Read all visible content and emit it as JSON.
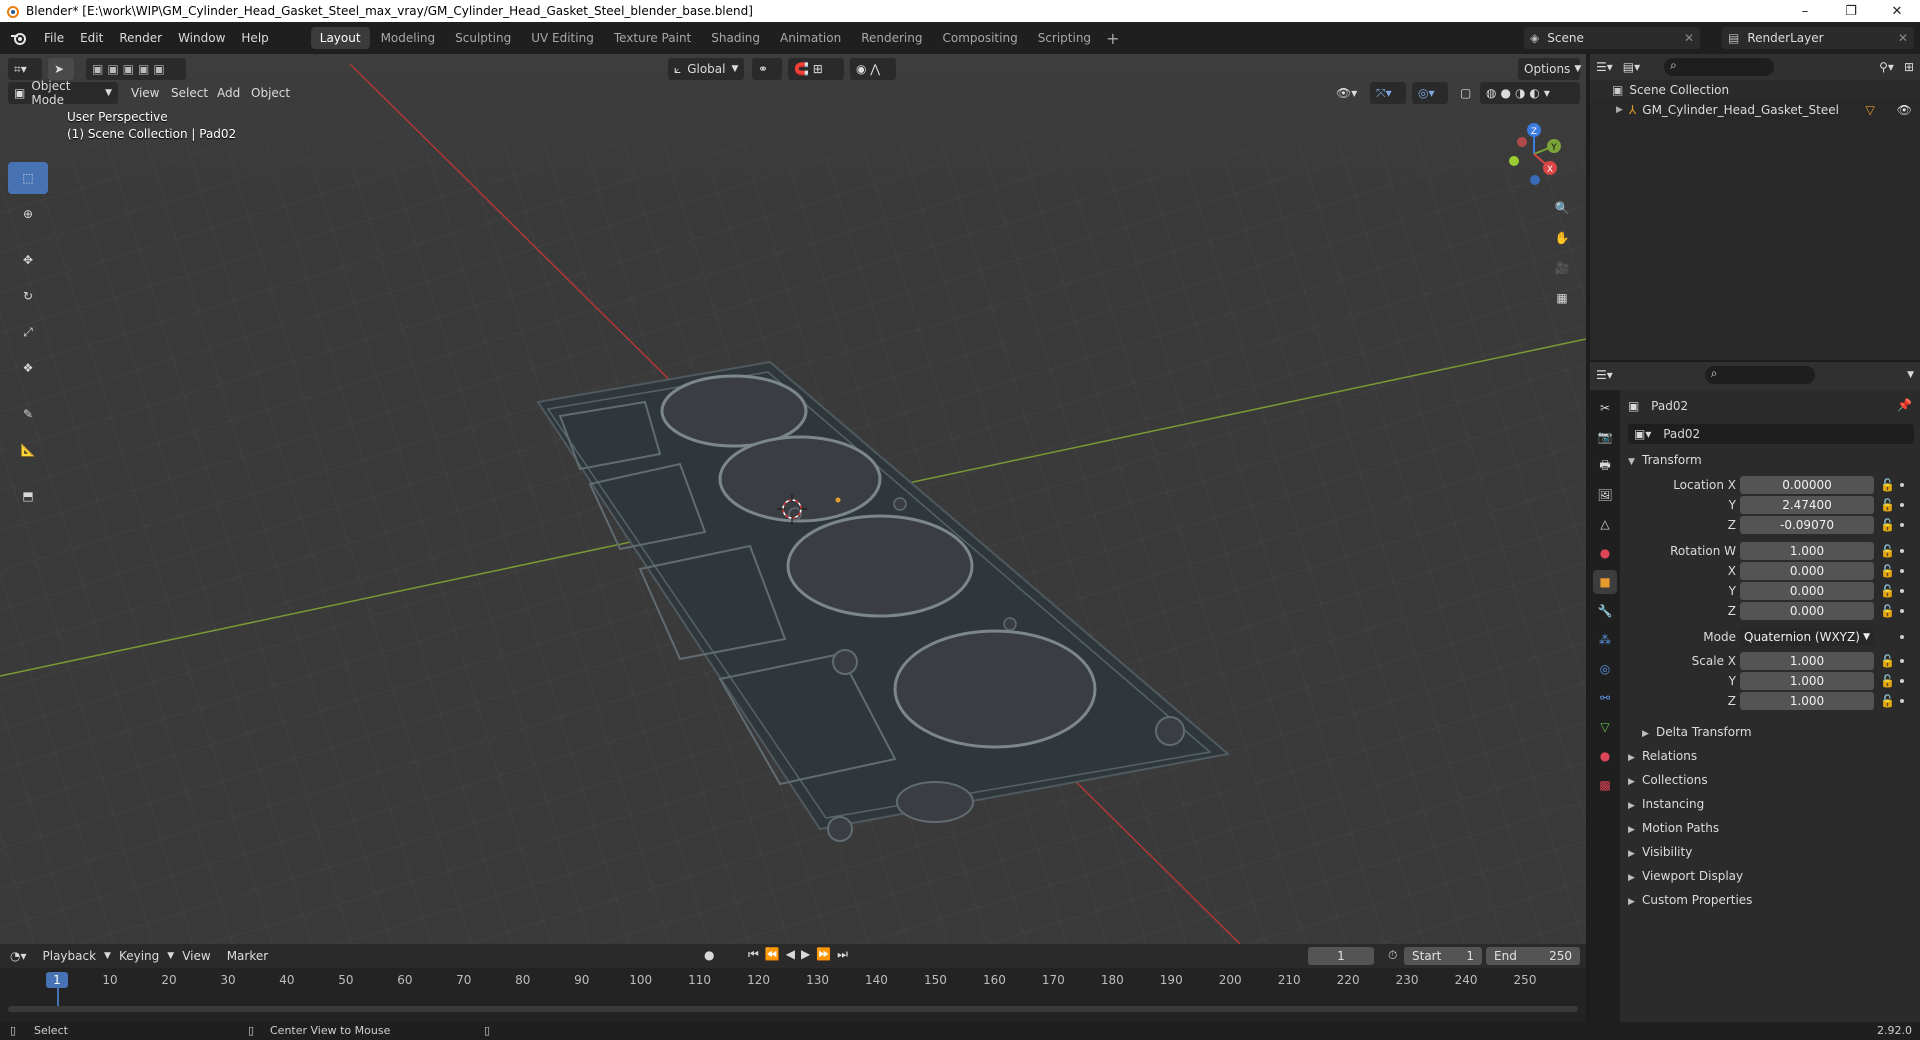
{
  "window": {
    "title": "Blender* [E:\\work\\WIP\\GM_Cylinder_Head_Gasket_Steel_max_vray/GM_Cylinder_Head_Gasket_Steel_blender_base.blend]",
    "minimize": "–",
    "restore": "❐",
    "close": "✕"
  },
  "menu": [
    "File",
    "Edit",
    "Render",
    "Window",
    "Help"
  ],
  "workspaces": [
    "Layout",
    "Modeling",
    "Sculpting",
    "UV Editing",
    "Texture Paint",
    "Shading",
    "Animation",
    "Rendering",
    "Compositing",
    "Scripting"
  ],
  "active_workspace": "Layout",
  "scene": "Scene",
  "render_layer": "RenderLayer",
  "viewport": {
    "mode": "Object Mode",
    "menus": [
      "View",
      "Select",
      "Add",
      "Object"
    ],
    "orientation": "Global",
    "options": "Options",
    "perspective": "User Perspective",
    "collection_info": "(1) Scene Collection | Pad02",
    "axes": {
      "x": "X",
      "y": "Y",
      "z": "Z"
    }
  },
  "outliner": {
    "root": "Scene Collection",
    "items": [
      {
        "name": "GM_Cylinder_Head_Gasket_Steel"
      }
    ]
  },
  "properties": {
    "object_name": "Pad02",
    "data_name": "Pad02",
    "transform_label": "Transform",
    "location": {
      "label": "Location X",
      "x": "0.00000",
      "y": "2.47400",
      "z": "-0.09070"
    },
    "rotation": {
      "label": "Rotation W",
      "w": "1.000",
      "x": "0.000",
      "y": "0.000",
      "z": "0.000"
    },
    "mode_label": "Mode",
    "mode_value": "Quaternion (WXYZ)",
    "scale": {
      "label": "Scale X",
      "x": "1.000",
      "y": "1.000",
      "z": "1.000"
    },
    "axis_labels": {
      "y": "Y",
      "z": "Z",
      "x": "X"
    },
    "delta": "Delta Transform",
    "sections": [
      "Relations",
      "Collections",
      "Instancing",
      "Motion Paths",
      "Visibility",
      "Viewport Display",
      "Custom Properties"
    ]
  },
  "timeline": {
    "menus": [
      "Playback",
      "Keying",
      "View",
      "Marker"
    ],
    "current_frame": "1",
    "start_label": "Start",
    "start": "1",
    "end_label": "End",
    "end": "250",
    "ticks": [
      "1",
      "10",
      "20",
      "30",
      "40",
      "50",
      "60",
      "70",
      "80",
      "90",
      "100",
      "110",
      "120",
      "130",
      "140",
      "150",
      "160",
      "170",
      "180",
      "190",
      "200",
      "210",
      "220",
      "230",
      "240",
      "250"
    ]
  },
  "status": {
    "left": "Select",
    "middle": "Center View to Mouse",
    "version": "2.92.0"
  }
}
